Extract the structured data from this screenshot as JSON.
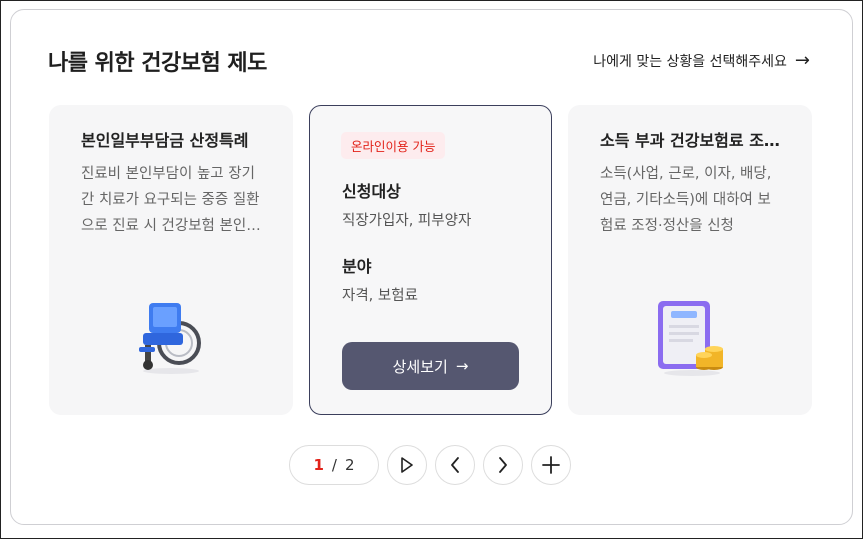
{
  "header": {
    "title": "나를 위한 건강보험 제도",
    "situation_link": "나에게 맞는 상황을 선택해주세요",
    "situation_arrow": "→"
  },
  "cards": [
    {
      "title": "본인일부부담금 산정특례",
      "description": "진료비 본인부담이 높고 장기간 치료가 요구되는 중증 질환으로 진료 시 건강보험 본인부담을 경감",
      "illustration": "wheelchair-icon"
    },
    {
      "badge": "온라인이용 가능",
      "target_label": "신청대상",
      "target_value": "직장가입자, 피부양자",
      "field_label": "분야",
      "field_value": "자격, 보험료",
      "detail_button": "상세보기",
      "detail_arrow": "→"
    },
    {
      "title": "소득 부과 건강보험료 조정·정산",
      "description": "소득(사업, 근로, 이자, 배당, 연금, 기타소득)에 대하여 보험료 조정·정산을 신청",
      "illustration": "document-coins-icon"
    }
  ],
  "pagination": {
    "current": "1",
    "separator": "/",
    "total": "2"
  },
  "colors": {
    "accent_red": "#e2231a",
    "button_bg": "#555770",
    "card_bg": "#f6f6f7"
  }
}
